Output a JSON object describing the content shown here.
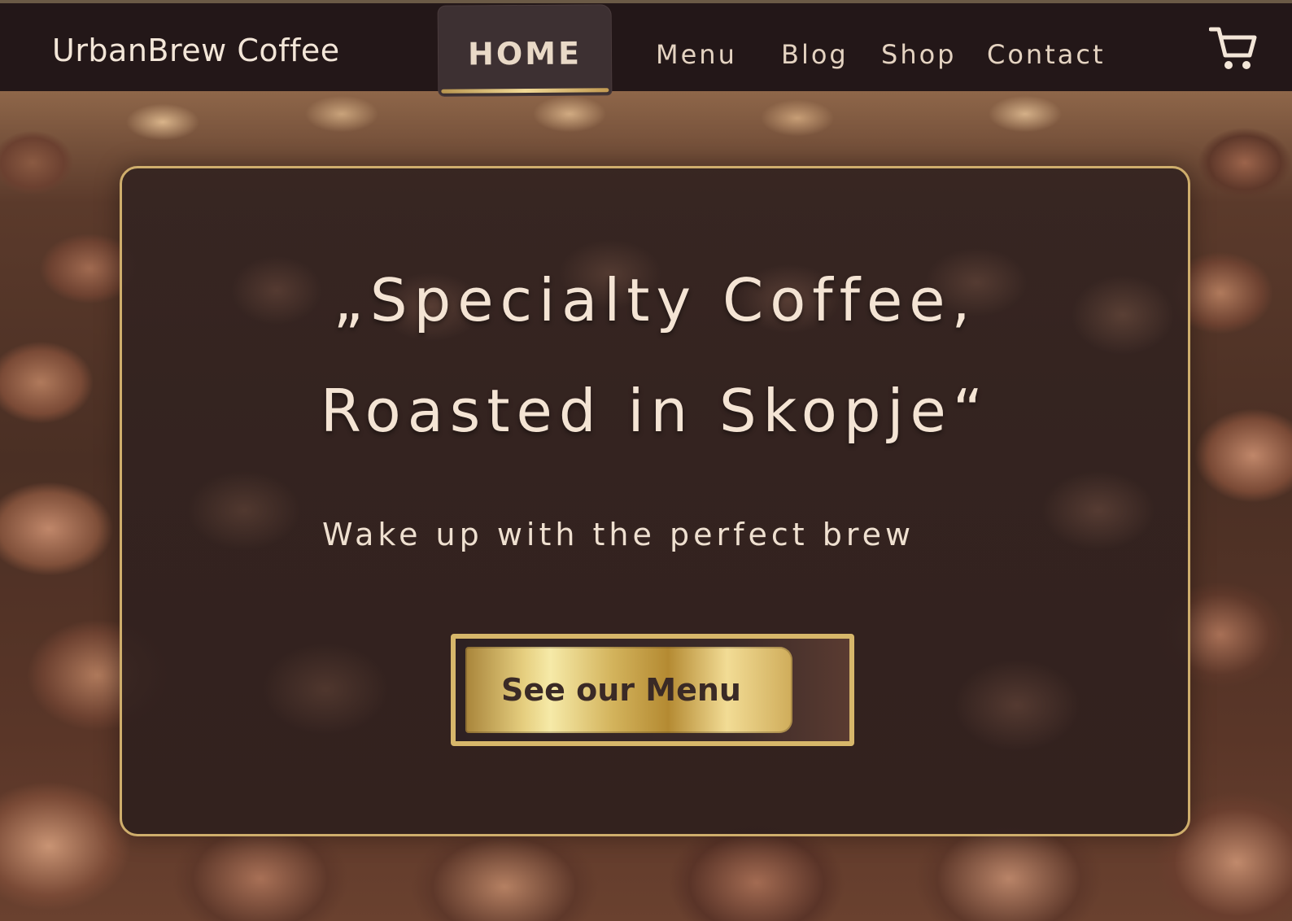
{
  "brand": {
    "name": "UrbanBrew Coffee"
  },
  "nav": {
    "active": "HOME",
    "items": [
      {
        "label": "HOME"
      },
      {
        "label": "Menu"
      },
      {
        "label": "Blog"
      },
      {
        "label": "Shop"
      },
      {
        "label": "Contact"
      }
    ],
    "cart_icon": "cart-icon"
  },
  "hero": {
    "headline_line1": "„Specialty Coffee,",
    "headline_line2": "Roasted in Skopje“",
    "subline": "Wake up with the perfect brew",
    "cta_label": "See our Menu"
  },
  "colors": {
    "nav_background": "#231718",
    "accent_gold": "#cfae6c",
    "text_cream": "#f4e4d4",
    "button_text": "#3a2a26"
  }
}
